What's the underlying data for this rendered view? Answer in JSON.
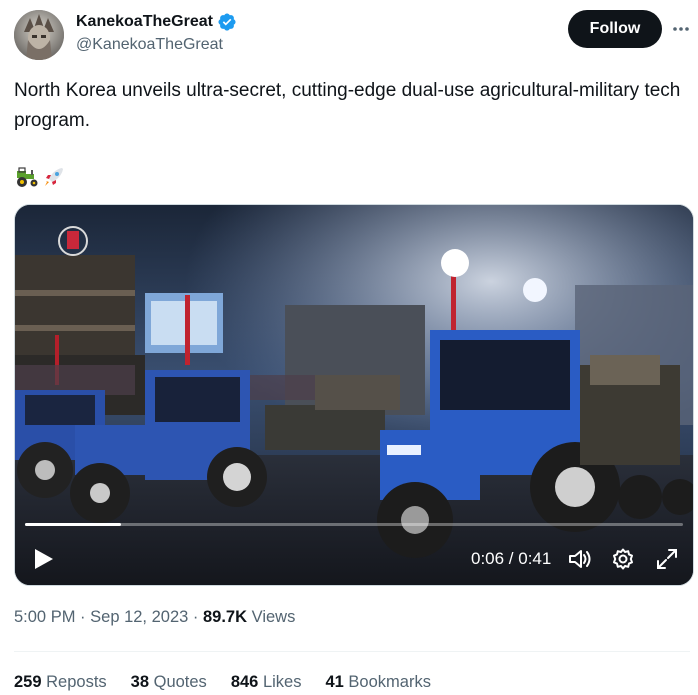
{
  "author": {
    "display_name": "KanekoaTheGreat",
    "handle": "@KanekoaTheGreat",
    "verified": true,
    "avatar_icon": "avatar-image"
  },
  "header": {
    "follow_label": "Follow",
    "more_icon": "more-dots-icon"
  },
  "tweet": {
    "text": "North Korea unveils ultra-secret, cutting-edge dual-use agricultural-military tech program.",
    "emojis": [
      "tractor-emoji",
      "rocket-emoji"
    ]
  },
  "video": {
    "time": "0:06 / 0:41",
    "progress": 0.146,
    "controls": [
      "play-icon",
      "volume-icon",
      "settings-icon",
      "fullscreen-icon"
    ]
  },
  "meta": {
    "time": "5:00 PM",
    "date": "Sep 12, 2023",
    "views_count": "89.7K",
    "views_label": "Views"
  },
  "stats": [
    {
      "count": "259",
      "label": "Reposts"
    },
    {
      "count": "38",
      "label": "Quotes"
    },
    {
      "count": "846",
      "label": "Likes"
    },
    {
      "count": "41",
      "label": "Bookmarks"
    }
  ],
  "colors": {
    "text": "#0f1419",
    "muted": "#536471",
    "verified": "#1d9bf0",
    "follow_bg": "#0f1419"
  }
}
